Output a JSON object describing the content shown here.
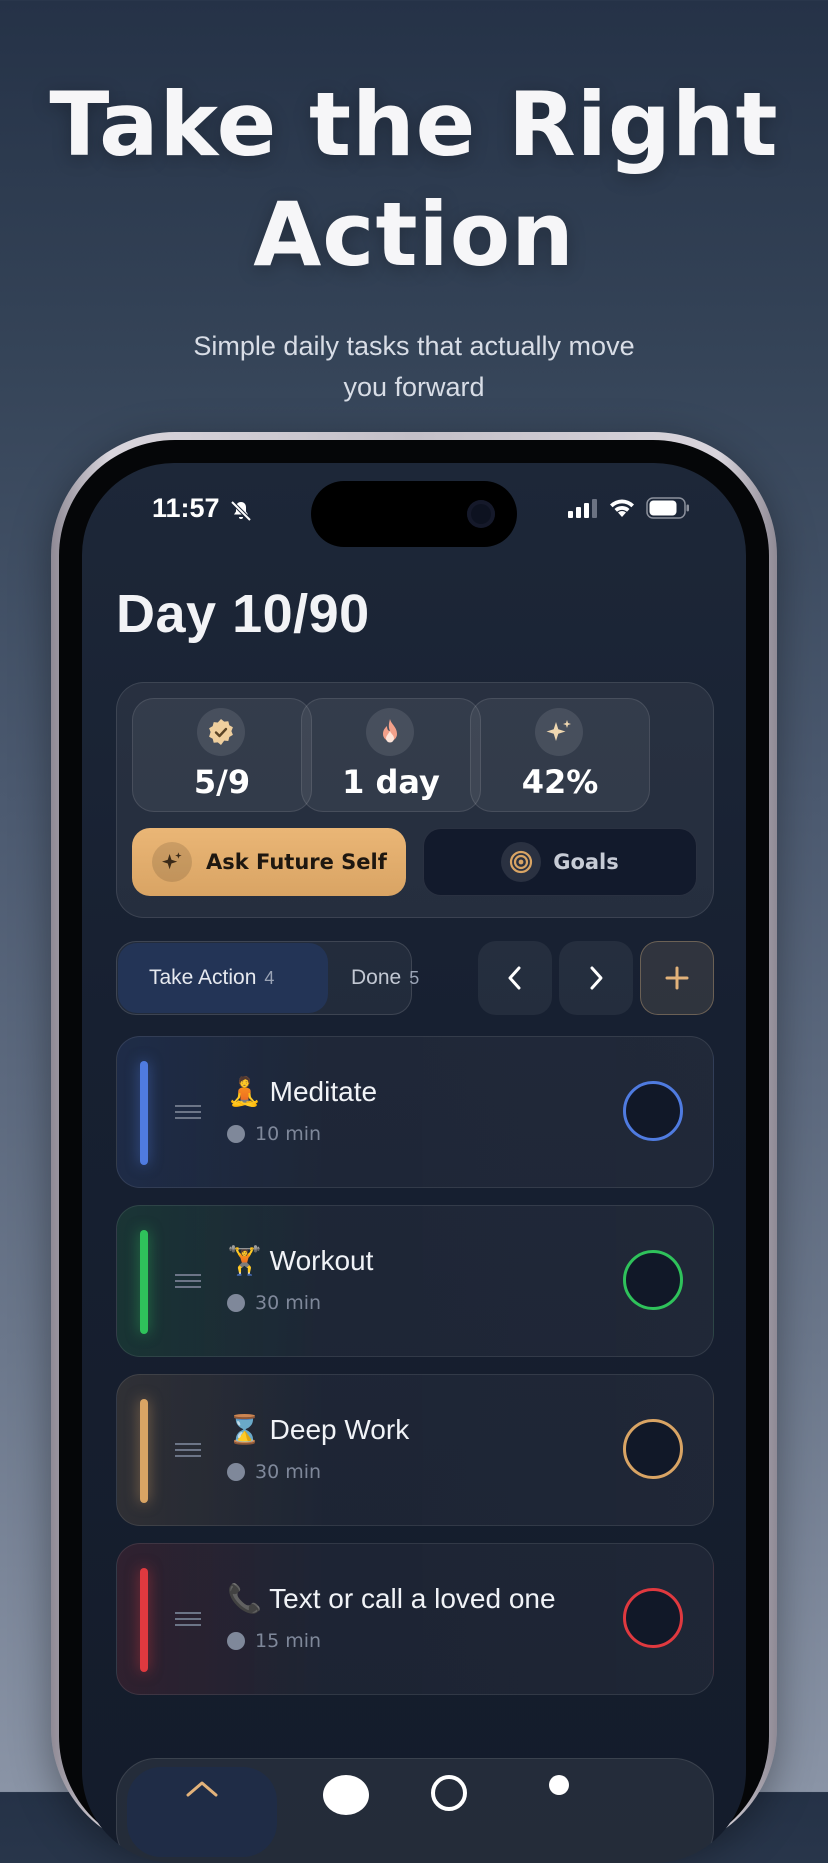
{
  "hero": {
    "title_line1": "Take the Right",
    "title_line2": "Action",
    "subtitle_line1": "Simple daily tasks that actually move",
    "subtitle_line2": "you forward"
  },
  "status_bar": {
    "time": "11:57"
  },
  "header": {
    "day_title": "Day 10/90"
  },
  "stats": [
    {
      "icon": "check-badge-icon",
      "value": "5/9"
    },
    {
      "icon": "flame-icon",
      "value": "1 day"
    },
    {
      "icon": "sparkle-icon",
      "value": "42%"
    }
  ],
  "actions": {
    "future_label": "Ask Future Self",
    "goals_label": "Goals"
  },
  "tabs": [
    {
      "label": "Take Action",
      "count": "4",
      "active": true
    },
    {
      "label": "Done",
      "count": "5",
      "active": false
    }
  ],
  "tasks": [
    {
      "emoji": "🧘",
      "title": "Meditate",
      "duration": "10 min",
      "color": "#4f7be0"
    },
    {
      "emoji": "🏋️",
      "title": "Workout",
      "duration": "30 min",
      "color": "#2fc25b"
    },
    {
      "emoji": "⌛",
      "title": "Deep Work",
      "duration": "30 min",
      "color": "#d9a464"
    },
    {
      "emoji": "📞",
      "title": "Text or call a loved one",
      "duration": "15 min",
      "color": "#e0393f"
    }
  ],
  "colors": {
    "accent": "#eab676",
    "background": "#172031"
  }
}
